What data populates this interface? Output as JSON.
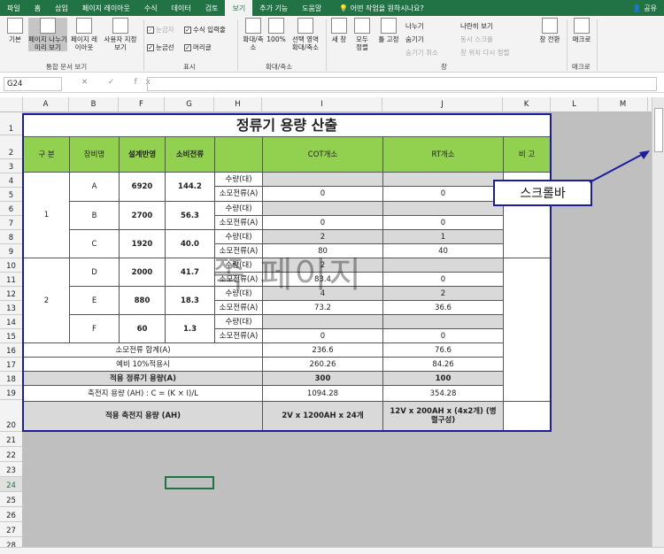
{
  "menu": [
    "파일",
    "홈",
    "삽입",
    "페이지 레이아웃",
    "수식",
    "데이터",
    "검토",
    "보기",
    "추가 기능",
    "도움말"
  ],
  "tell_me": "어떤 작업을 원하시나요?",
  "share": "공유",
  "ribbon": {
    "views": {
      "normal": "기본",
      "page_break": "페이지 나누기 미리 보기",
      "page_layout": "페이지 레이아웃",
      "custom": "사용자 지정 보기",
      "group": "통합 문서 보기"
    },
    "show": {
      "ruler": "눈금자",
      "gridlines": "눈금선",
      "formula_bar": "수식 입력줄",
      "headings": "머리글",
      "group": "표시"
    },
    "zoom": {
      "zoom": "확대/축소",
      "hundred": "100%",
      "selection": "선택 영역 확대/축소",
      "group": "확대/축소"
    },
    "window": {
      "new": "새 창",
      "arrange": "모두 정렬",
      "freeze": "틀 고정",
      "split": "나누기",
      "hide": "숨기기",
      "unhide": "숨기기 취소",
      "side": "나란히 보기",
      "sync": "동시 스크롤",
      "reset": "창 위치 다시 정렬",
      "switch": "창 전환",
      "group": "창"
    },
    "macro": {
      "label": "매크로",
      "group": "매크로"
    }
  },
  "namebox": "G24",
  "fx": "✕ ✓ fx",
  "columns": [
    "A",
    "B",
    "F",
    "G",
    "H",
    "I",
    "J",
    "K",
    "L",
    "M"
  ],
  "rows": [
    "1",
    "2",
    "3",
    "4",
    "5",
    "6",
    "7",
    "8",
    "9",
    "10",
    "11",
    "12",
    "13",
    "14",
    "15",
    "16",
    "17",
    "18",
    "19",
    "20",
    "21",
    "22",
    "23",
    "24",
    "25",
    "26",
    "27",
    "28"
  ],
  "selected_row": "24",
  "table": {
    "title": "정류기 용량 산출",
    "h_gubun": "구 분",
    "h_equip": "장비명",
    "h_design": "설계반영",
    "h_current": "소비전류",
    "h_cot": "COT개소",
    "h_rt": "RT개소",
    "h_note": "비 고",
    "qty": "수량(대)",
    "cur": "소모전류(A)",
    "g1": "1",
    "g2": "2",
    "A": {
      "name": "A",
      "design": "6920",
      "cur": "144.2",
      "cot_q": "",
      "cot_c": "0",
      "rt_q": "",
      "rt_c": "0"
    },
    "B": {
      "name": "B",
      "design": "2700",
      "cur": "56.3",
      "cot_q": "",
      "cot_c": "0",
      "rt_q": "",
      "rt_c": "0"
    },
    "C": {
      "name": "C",
      "design": "1920",
      "cur": "40.0",
      "cot_q": "2",
      "cot_c": "80",
      "rt_q": "1",
      "rt_c": "40"
    },
    "D": {
      "name": "D",
      "design": "2000",
      "cur": "41.7",
      "cot_q": "2",
      "cot_c": "83.4",
      "rt_q": "",
      "rt_c": "0"
    },
    "E": {
      "name": "E",
      "design": "880",
      "cur": "18.3",
      "cot_q": "4",
      "cot_c": "73.2",
      "rt_q": "2",
      "rt_c": "36.6"
    },
    "F": {
      "name": "F",
      "design": "60",
      "cur": "1.3",
      "cot_q": "",
      "cot_c": "0",
      "rt_q": "",
      "rt_c": "0"
    },
    "sum_label": "소모전류 합계(A)",
    "sum_cot": "236.6",
    "sum_rt": "76.6",
    "spare_label": "예비 10%적용시",
    "spare_cot": "260.26",
    "spare_rt": "84.26",
    "rect_label": "적용 정류기 용량(A)",
    "rect_cot": "300",
    "rect_rt": "100",
    "bat_label": "축전지 용량 (AH) : C = (K × I)/L",
    "bat_cot": "1094.28",
    "bat_rt": "354.28",
    "apply_label": "적용 축전지 용량 (AH)",
    "apply_cot": "2V x 1200AH x 24개",
    "apply_rt": "12V x 200AH x (4x2개) (병렬구성)"
  },
  "callout": "스크롤바",
  "watermark": "쪽 페이지"
}
